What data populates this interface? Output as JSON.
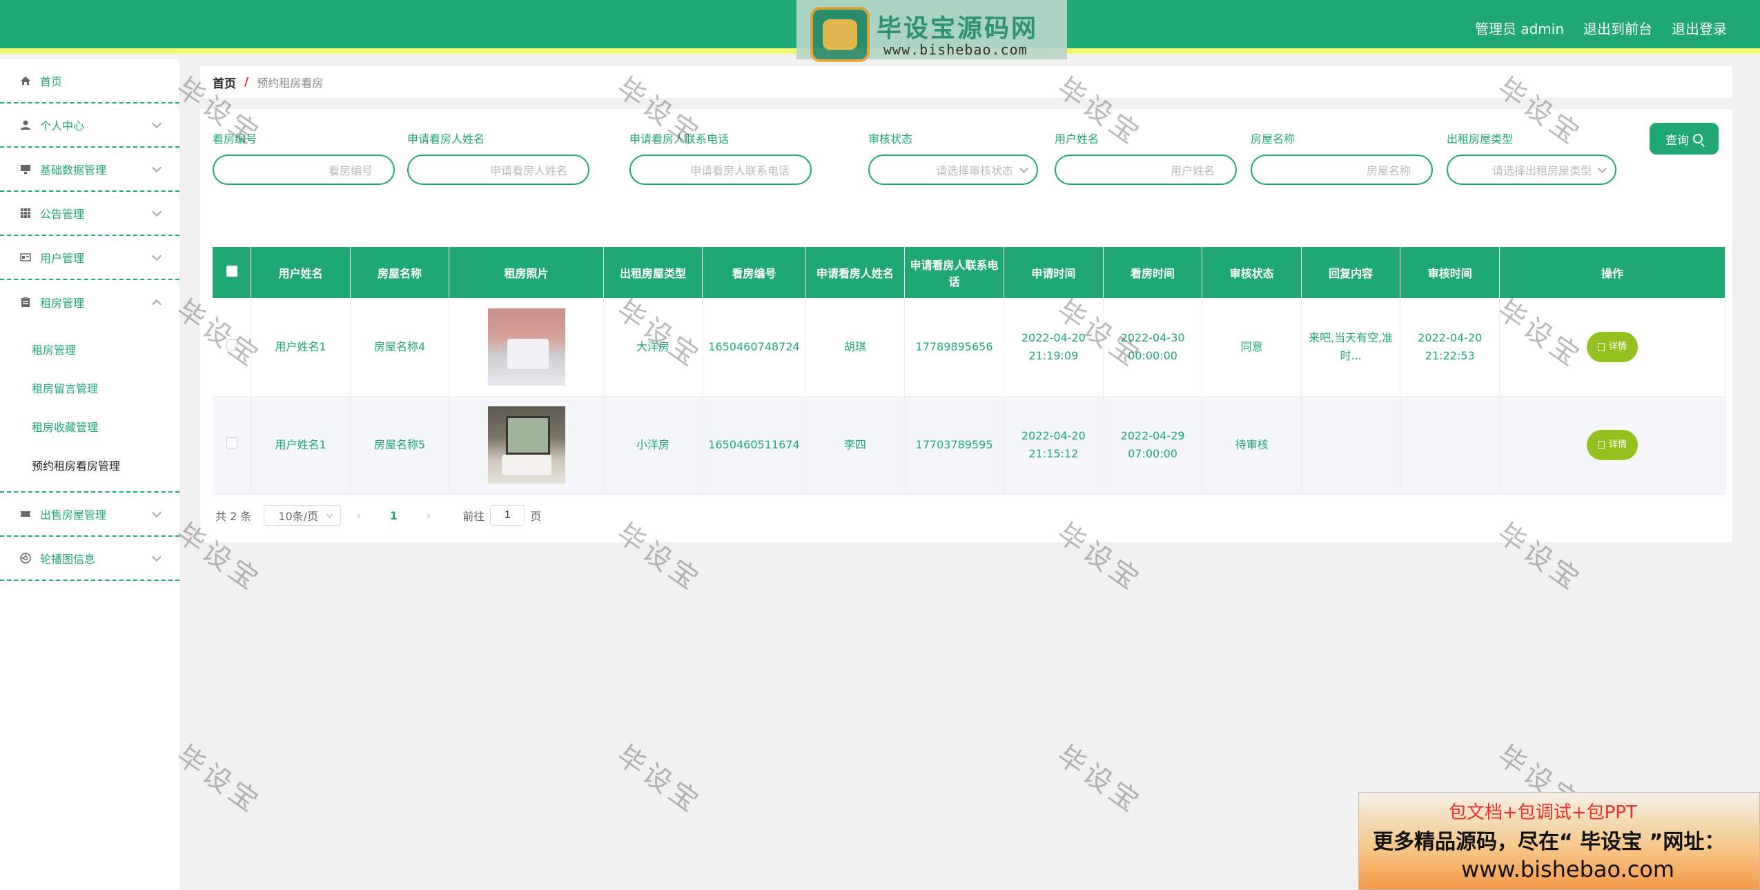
{
  "header": {
    "admin_label": "管理员 admin",
    "back_label": "退出到前台",
    "logout_label": "退出登录",
    "logo_title": "毕设宝源码网",
    "logo_url": "www.bishebao.com",
    "accent_color": "#1fa774"
  },
  "sidebar": {
    "items": [
      {
        "label": "首页",
        "icon": "home-icon"
      },
      {
        "label": "个人中心",
        "icon": "user-icon"
      },
      {
        "label": "基础数据管理",
        "icon": "monitor-icon"
      },
      {
        "label": "公告管理",
        "icon": "grid-icon"
      },
      {
        "label": "用户管理",
        "icon": "id-card-icon"
      },
      {
        "label": "租房管理",
        "icon": "clipboard-icon"
      },
      {
        "label": "出售房屋管理",
        "icon": "ticket-icon"
      },
      {
        "label": "轮播图信息",
        "icon": "aperture-icon"
      }
    ],
    "sub_items": [
      {
        "label": "租房管理"
      },
      {
        "label": "租房留言管理"
      },
      {
        "label": "租房收藏管理"
      },
      {
        "label": "预约租房看房管理"
      }
    ]
  },
  "breadcrumb": {
    "home": "首页",
    "separator": "/",
    "current": "预约租房看房"
  },
  "filters": [
    {
      "label": "看房编号",
      "placeholder": "看房编号"
    },
    {
      "label": "申请看房人姓名",
      "placeholder": "申请看房人姓名"
    },
    {
      "label": "申请看房人联系电话",
      "placeholder": "申请看房人联系电话"
    },
    {
      "label": "审核状态",
      "placeholder": "请选择审核状态"
    },
    {
      "label": "用户姓名",
      "placeholder": "用户姓名"
    },
    {
      "label": "房屋名称",
      "placeholder": "房屋名称"
    },
    {
      "label": "出租房屋类型",
      "placeholder": "请选择出租房屋类型"
    }
  ],
  "search_label": "查询",
  "table": {
    "headers": [
      "用户姓名",
      "房屋名称",
      "租房照片",
      "出租房屋类型",
      "看房编号",
      "申请看房人姓名",
      "申请看房人联系电话",
      "申请时间",
      "看房时间",
      "审核状态",
      "回复内容",
      "审核时间",
      "操作"
    ],
    "rows": [
      {
        "user": "用户姓名1",
        "house": "房屋名称4",
        "type": "大洋房",
        "code": "1650460748724",
        "applicant": "胡琪",
        "phone": "17789895656",
        "apply_time": "2022-04-20 21:19:09",
        "view_time": "2022-04-30 00:00:00",
        "status": "同意",
        "reply": "来吧,当天有空,准时...",
        "review_time": "2022-04-20 21:22:53",
        "action": "详情"
      },
      {
        "user": "用户姓名1",
        "house": "房屋名称5",
        "type": "小洋房",
        "code": "1650460511674",
        "applicant": "李四",
        "phone": "17703789595",
        "apply_time": "2022-04-20 21:15:12",
        "view_time": "2022-04-29 07:00:00",
        "status": "待审核",
        "reply": "",
        "review_time": "",
        "action": "详情"
      }
    ]
  },
  "pager": {
    "total": "共 2 条",
    "page_size": "10条/页",
    "prev": "‹",
    "page": "1",
    "next": "›",
    "goto_prefix": "前往",
    "goto_value": "1",
    "goto_suffix": "页"
  },
  "watermark": "毕设宝",
  "ad": {
    "line1": "包文档+包调试+包PPT",
    "line2": "更多精品源码，尽在“ 毕设宝 ”网址：",
    "line3": "www.bishebao.com"
  }
}
